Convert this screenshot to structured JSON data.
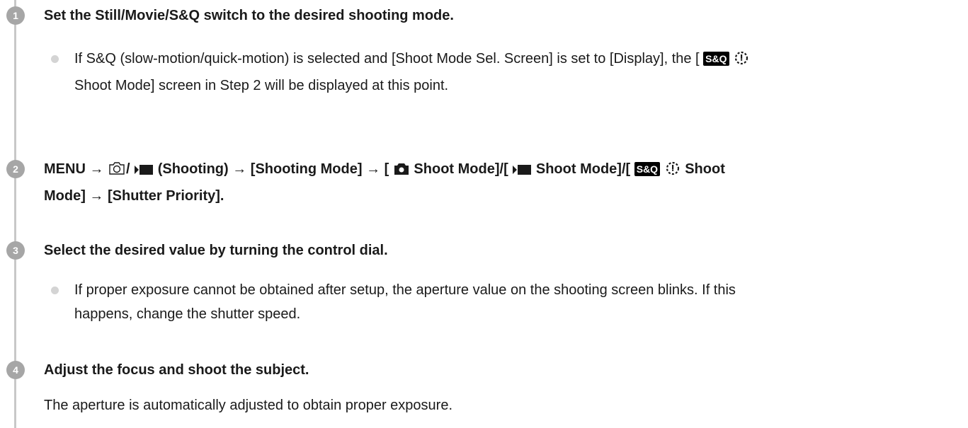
{
  "steps": [
    {
      "number": "1",
      "title": "Set the Still/Movie/S&Q switch to the desired shooting mode.",
      "bullet": {
        "part1": "If S&Q (slow-motion/quick-motion) is selected and [Shoot Mode Sel. Screen] is set to [Display], the [",
        "badge": "S&Q",
        "part2_line2": "Shoot Mode] screen in Step 2 will be displayed at this point."
      }
    },
    {
      "number": "2",
      "menu": {
        "p1": "MENU →",
        "p2": "/",
        "p3": "(Shooting) → [Shooting Mode] → [",
        "p4": "Shoot Mode]/[",
        "p5": "Shoot Mode]/[",
        "badge": "S&Q",
        "p6": "Shoot",
        "line2": "Mode] → [Shutter Priority]."
      }
    },
    {
      "number": "3",
      "title": "Select the desired value by turning the control dial.",
      "bullet_line1": "If proper exposure cannot be obtained after setup, the aperture value on the shooting screen blinks. If this",
      "bullet_line2": "happens, change the shutter speed."
    },
    {
      "number": "4",
      "title": "Adjust the focus and shoot the subject.",
      "text": "The aperture is automatically adjusted to obtain proper exposure."
    }
  ],
  "icons": {
    "still": "camera-outline-icon",
    "movie": "movie-icon",
    "still_filled": "camera-filled-icon",
    "sq": "sq-badge",
    "dial": "dial-mode-icon"
  },
  "colors": {
    "step_circle": "#a6a6a6",
    "timeline": "#c8c8c8",
    "bullet": "#d4d4d4",
    "text": "#1a1a1a"
  }
}
